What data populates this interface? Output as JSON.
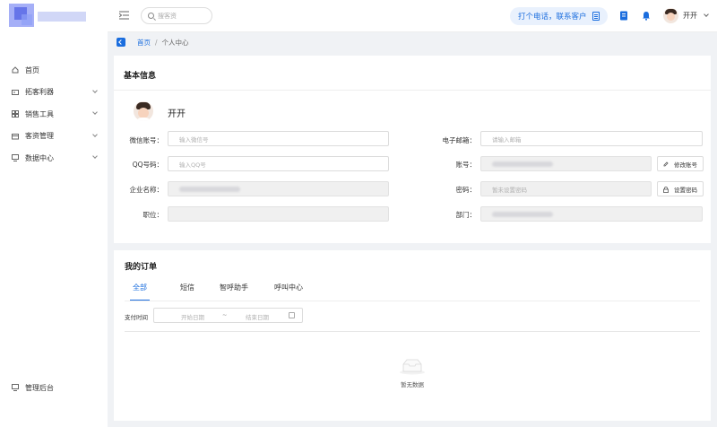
{
  "sidebar": {
    "items": [
      {
        "label": "首页",
        "icon": "home-icon",
        "expandable": false
      },
      {
        "label": "拓客利器",
        "icon": "card-icon",
        "expandable": true
      },
      {
        "label": "销售工具",
        "icon": "grid-icon",
        "expandable": true
      },
      {
        "label": "客资管理",
        "icon": "folder-icon",
        "expandable": true
      },
      {
        "label": "数据中心",
        "icon": "monitor-icon",
        "expandable": true
      }
    ],
    "bottom": {
      "label": "管理后台",
      "icon": "monitor-icon"
    }
  },
  "header": {
    "search_placeholder": "搜客资",
    "call_button": "打个电话，联系客户",
    "username": "开开"
  },
  "breadcrumb": {
    "home": "首页",
    "separator": "/",
    "current": "个人中心"
  },
  "profile": {
    "section_title": "基本信息",
    "name": "开开",
    "fields": {
      "wechat": {
        "label": "微信账号：",
        "placeholder": "输入微信号"
      },
      "email": {
        "label": "电子邮箱：",
        "placeholder": "请输入邮箱"
      },
      "qq": {
        "label": "QQ号码：",
        "placeholder": "输入QQ号"
      },
      "account": {
        "label": "账号：",
        "button": "修改账号"
      },
      "company": {
        "label": "企业名称："
      },
      "password": {
        "label": "密码：",
        "placeholder": "暂未设置密码",
        "button": "设置密码"
      },
      "position": {
        "label": "职位："
      },
      "department": {
        "label": "部门："
      }
    }
  },
  "orders": {
    "section_title": "我的订单",
    "tabs": [
      "全部",
      "短信",
      "智呼助手",
      "呼叫中心"
    ],
    "active_tab": 0,
    "filter_label": "支付时间",
    "date_start_placeholder": "开始日期",
    "date_separator": "~",
    "date_end_placeholder": "结束日期",
    "empty_text": "暂无数据"
  },
  "colors": {
    "accent": "#1a6dde",
    "accent_bg": "#e9f1fd",
    "page_bg": "#f0f2f5"
  }
}
